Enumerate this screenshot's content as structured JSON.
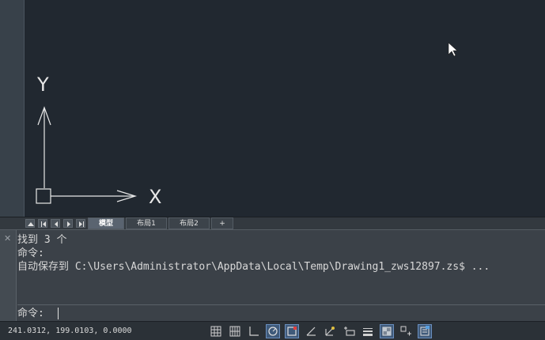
{
  "viewport": {
    "axis_y_label": "Y",
    "axis_x_label": "X"
  },
  "layout_tabs": {
    "tabs": [
      {
        "label": "模型",
        "active": true
      },
      {
        "label": "布局1",
        "active": false
      },
      {
        "label": "布局2",
        "active": false
      },
      {
        "label": "+",
        "active": false
      }
    ]
  },
  "command": {
    "history": [
      "找到 3 个",
      "命令:",
      "自动保存到 C:\\Users\\Administrator\\AppData\\Local\\Temp\\Drawing1_zws12897.zs$ ..."
    ],
    "prompt": "命令:",
    "close_icon": "close-icon"
  },
  "status": {
    "coordinates": "241.0312, 199.0103, 0.0000",
    "buttons": [
      {
        "icon": "grid-display-icon",
        "on": false
      },
      {
        "icon": "snap-grid-icon",
        "on": false
      },
      {
        "icon": "ortho-icon",
        "on": false
      },
      {
        "icon": "polar-tracking-icon",
        "on": true
      },
      {
        "icon": "object-snap-icon",
        "on": true
      },
      {
        "icon": "object-snap-tracking-icon",
        "on": false
      },
      {
        "icon": "dynamic-ucs-icon",
        "on": false
      },
      {
        "icon": "dynamic-input-icon",
        "on": false
      },
      {
        "icon": "lineweight-icon",
        "on": false
      },
      {
        "icon": "transparency-icon",
        "on": true
      },
      {
        "icon": "selection-cycling-icon",
        "on": false
      },
      {
        "icon": "quick-properties-icon",
        "on": true
      }
    ]
  },
  "colors": {
    "canvas_background": "#212830",
    "panel_background": "#3b4148",
    "toggle_on": "#3f5a7a"
  }
}
